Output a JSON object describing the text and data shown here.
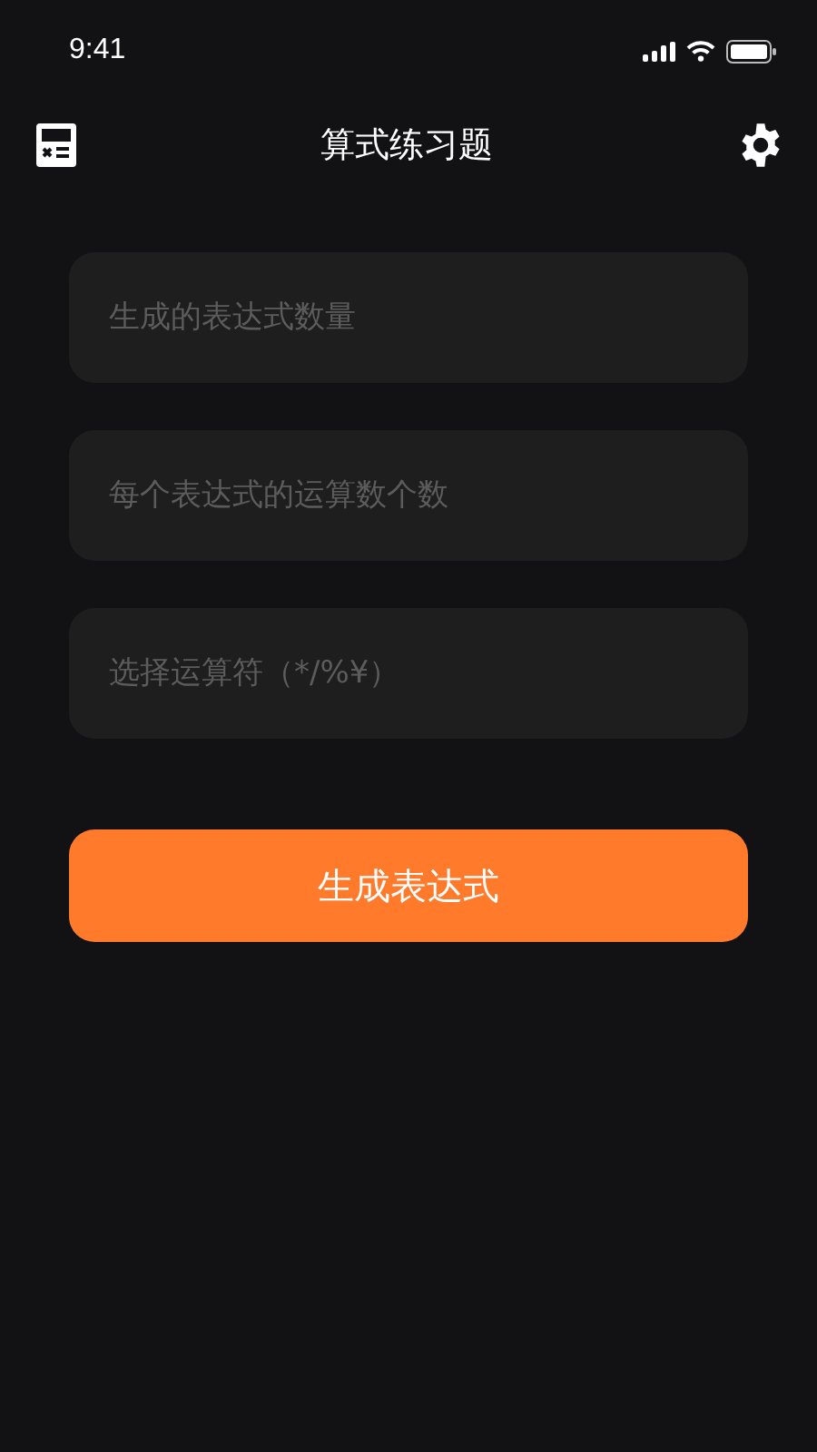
{
  "status_bar": {
    "time": "9:41"
  },
  "nav": {
    "title": "算式练习题"
  },
  "fields": [
    {
      "placeholder": "生成的表达式数量"
    },
    {
      "placeholder": "每个表达式的运算数个数"
    },
    {
      "placeholder": "选择运算符（*/%¥）"
    }
  ],
  "button": {
    "label": "生成表达式"
  }
}
